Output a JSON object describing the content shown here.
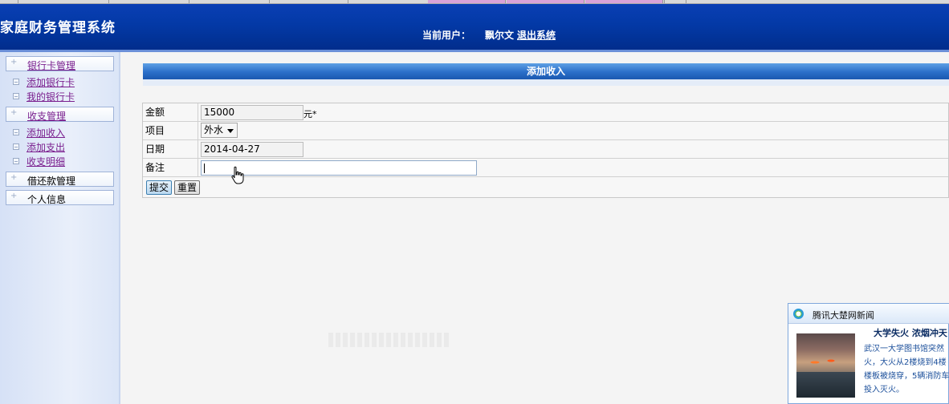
{
  "app": {
    "title": "家庭财务管理系统",
    "current_user_label": "当前用户：",
    "current_user": "飘尔文",
    "logout_label": "退出系统"
  },
  "sidebar": {
    "groups": [
      {
        "label": "银行卡管理",
        "items": [
          "添加银行卡",
          "我的银行卡"
        ]
      },
      {
        "label": "收支管理",
        "items": [
          "添加收入",
          "添加支出",
          "收支明细"
        ]
      },
      {
        "label": "借还款管理",
        "items": []
      },
      {
        "label": "个人信息",
        "items": []
      }
    ]
  },
  "panel": {
    "title": "添加收入"
  },
  "form": {
    "amount_label": "金额",
    "amount_value": "15000",
    "amount_unit": "元*",
    "category_label": "项目",
    "category_value": "外水",
    "date_label": "日期",
    "date_value": "2014-04-27",
    "note_label": "备注",
    "note_value": "",
    "submit_label": "提交",
    "reset_label": "重置"
  },
  "popup": {
    "title": "腾讯大楚网新闻",
    "headline": "大学失火 浓烟冲天",
    "body_lines": [
      "武汉一大学图书馆突然",
      "火，大火从2楼烧到4楼",
      "楼板被烧穿，5辆消防车",
      "投入灭火。"
    ]
  },
  "icons": {
    "popup_logo": "tencent-news-logo-icon",
    "cursor": "hand-pointer-icon",
    "menu_expand": "plus-icon",
    "menu_item": "square-bullet-icon"
  }
}
